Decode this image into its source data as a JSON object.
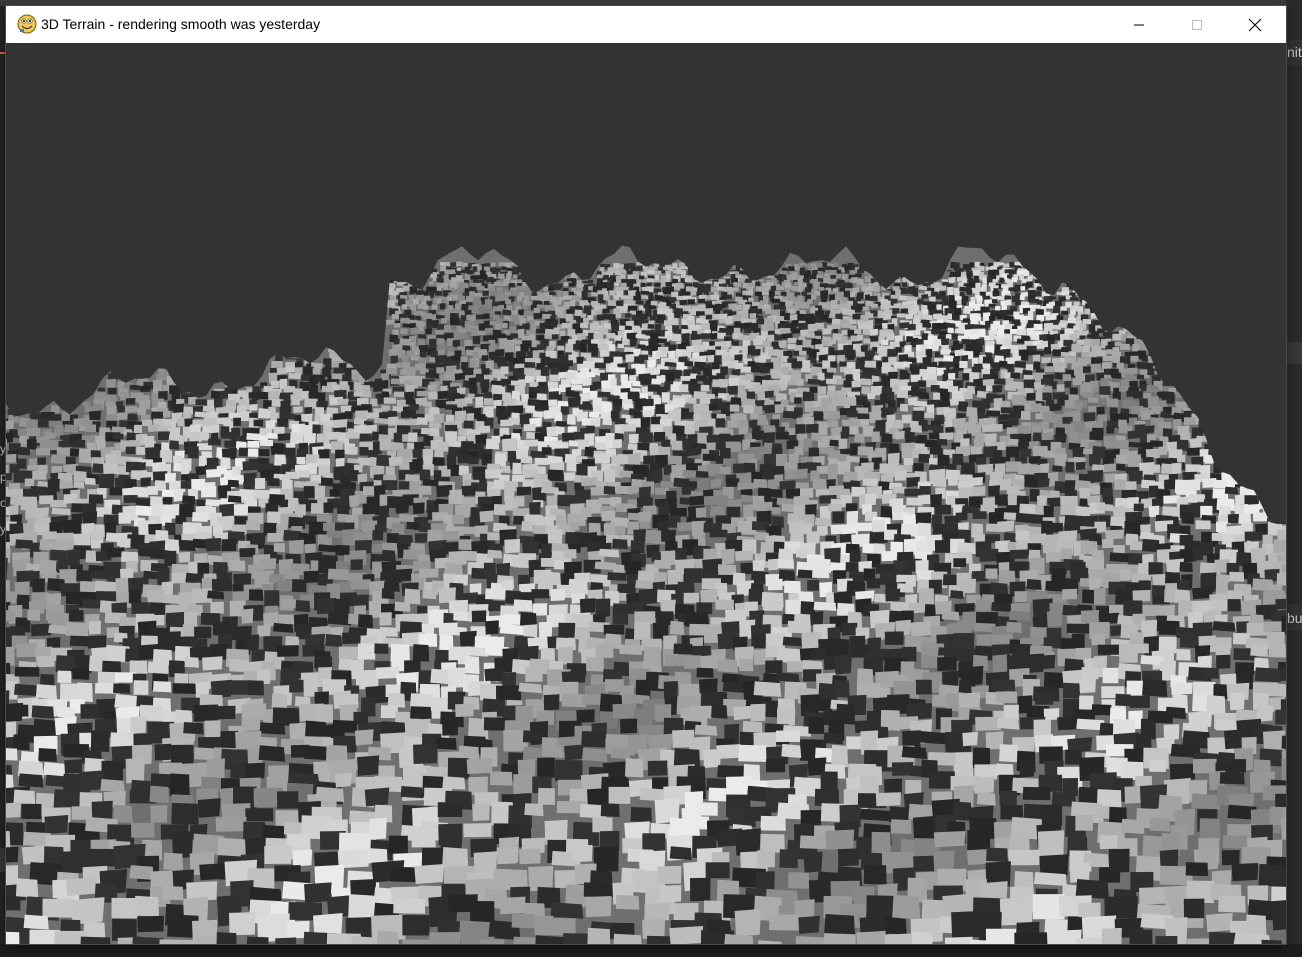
{
  "window": {
    "title": "3D Terrain - rendering smooth was yesterday",
    "icon": "pygame-snake-icon",
    "controls": {
      "minimize": "minimize-icon",
      "maximize": "maximize-icon",
      "close": "close-icon"
    }
  },
  "background": {
    "right_fragments": [
      "nit",
      "bu"
    ],
    "left_fragments": [
      "y",
      "p",
      "o",
      "y"
    ]
  },
  "colors": {
    "titlebar": "#ffffff",
    "viewport_bg": "#333333",
    "terrain_light": "#c8c8c8",
    "terrain_dark": "#2e2e2e"
  }
}
